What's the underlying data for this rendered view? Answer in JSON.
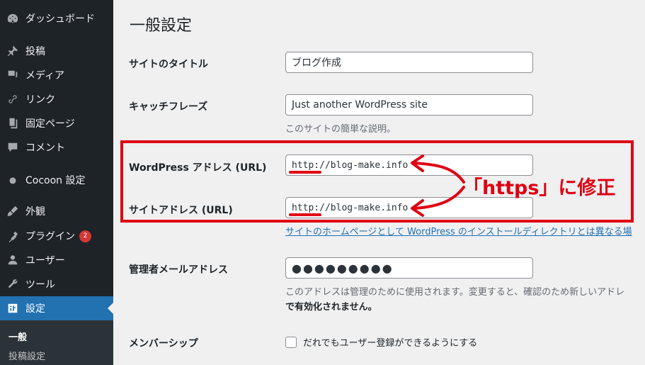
{
  "sidebar": {
    "items": [
      {
        "label": "ダッシュボード",
        "icon": "dashboard-icon"
      },
      {
        "label": "投稿",
        "icon": "pushpin-icon"
      },
      {
        "label": "メディア",
        "icon": "media-icon"
      },
      {
        "label": "リンク",
        "icon": "link-icon"
      },
      {
        "label": "固定ページ",
        "icon": "page-icon"
      },
      {
        "label": "コメント",
        "icon": "comment-icon"
      },
      {
        "label": "Cocoon 設定",
        "icon": "circle-icon"
      },
      {
        "label": "外観",
        "icon": "appearance-icon"
      },
      {
        "label": "プラグイン",
        "icon": "plugin-icon",
        "badge": "2"
      },
      {
        "label": "ユーザー",
        "icon": "user-icon"
      },
      {
        "label": "ツール",
        "icon": "wrench-icon"
      },
      {
        "label": "設定",
        "icon": "settings-icon",
        "active": true
      }
    ],
    "submenu": [
      {
        "label": "一般",
        "current": true
      },
      {
        "label": "投稿設定"
      }
    ]
  },
  "main": {
    "title": "一般設定",
    "site_title": {
      "label": "サイトのタイトル",
      "value": "ブログ作成"
    },
    "tagline": {
      "label": "キャッチフレーズ",
      "value": "Just another WordPress site",
      "description": "このサイトの簡単な説明。"
    },
    "wp_address": {
      "label": "WordPress アドレス (URL)",
      "value": "http://blog-make.info"
    },
    "site_address": {
      "label": "サイトアドレス (URL)",
      "value": "http://blog-make.info",
      "description": "サイトのホームページとして WordPress のインストールディレクトリとは異なる場"
    },
    "admin_email": {
      "label": "管理者メールアドレス",
      "value": "●●●●●●●●●",
      "description_line1": "このアドレスは管理のために使用されます。変更すると、確認のため新しいアドレ",
      "description_line2": "で有効化されません。"
    },
    "membership": {
      "label": "メンバーシップ",
      "checkbox_label": "だれでもユーザー登録ができるようにする",
      "checked": false
    }
  },
  "annotation": {
    "text": "「https」に修正",
    "color": "#e00012"
  },
  "colors": {
    "sidebar_bg": "#1d2327",
    "active_bg": "#2271b1",
    "link": "#2271b1",
    "badge": "#d63638"
  }
}
